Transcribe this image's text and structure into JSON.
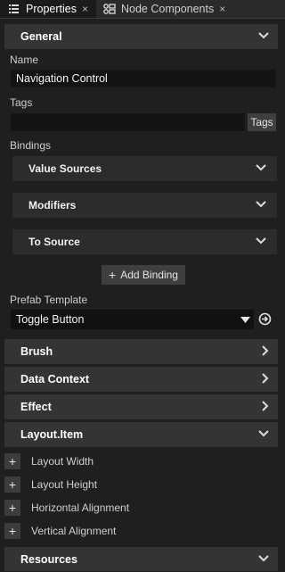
{
  "tabs": [
    {
      "label": "Properties",
      "icon": "list-icon",
      "active": true
    },
    {
      "label": "Node Components",
      "icon": "component-icon",
      "active": false
    }
  ],
  "sections": {
    "general": "General",
    "brush": "Brush",
    "data_context": "Data Context",
    "effect": "Effect",
    "layout_item": "Layout.Item",
    "resources": "Resources"
  },
  "name": {
    "label": "Name",
    "value": "Navigation Control"
  },
  "tags": {
    "label": "Tags",
    "value": "",
    "button": "Tags"
  },
  "bindings": {
    "label": "Bindings",
    "groups": [
      "Value Sources",
      "Modifiers",
      "To Source"
    ],
    "add_button": "Add Binding"
  },
  "prefab": {
    "label": "Prefab Template",
    "value": "Toggle Button"
  },
  "layout_properties": [
    "Layout Width",
    "Layout Height",
    "Horizontal Alignment",
    "Vertical Alignment"
  ],
  "colors": {
    "background": "#1f1f1f",
    "section": "#343434",
    "field": "#141414"
  }
}
